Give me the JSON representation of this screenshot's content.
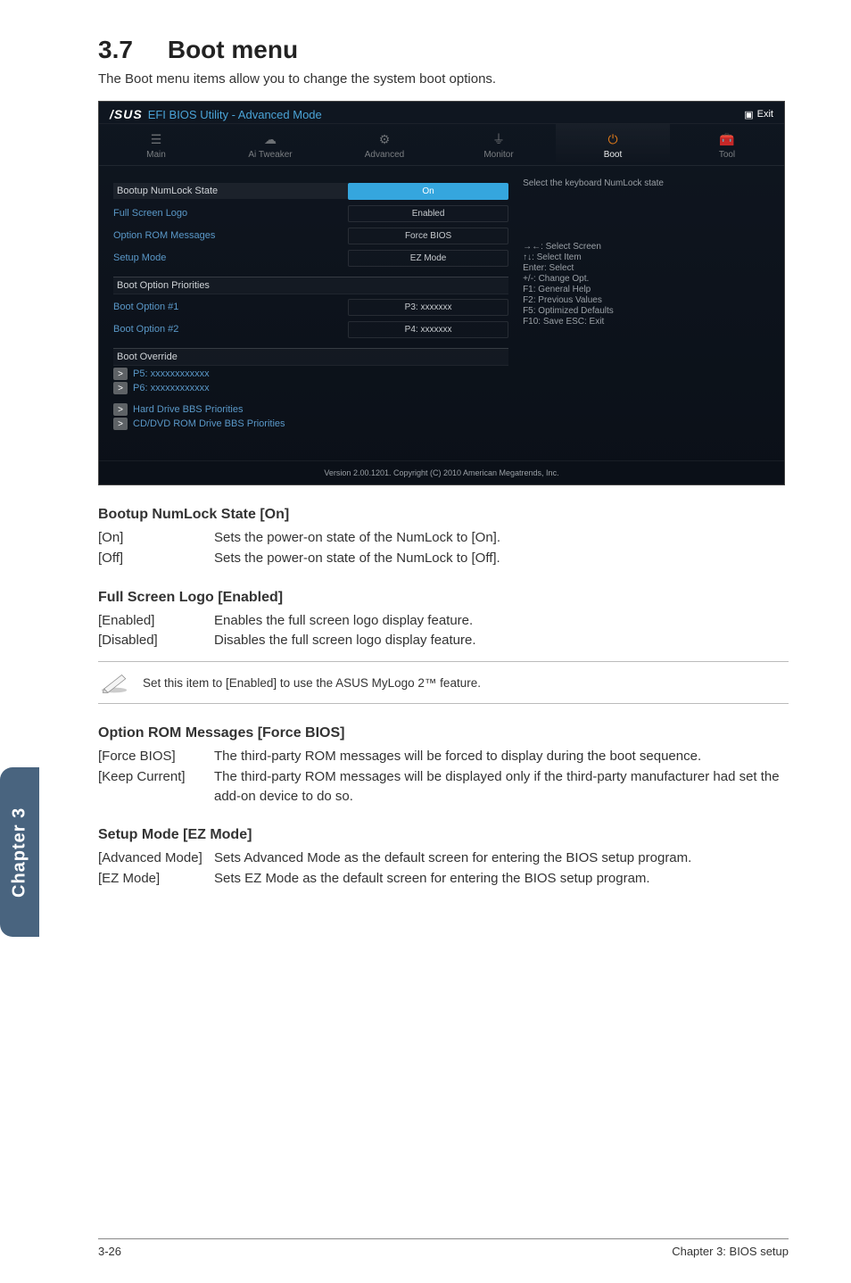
{
  "section": {
    "number": "3.7",
    "title": "Boot menu"
  },
  "intro": "The Boot menu items allow you to change the system boot options.",
  "bios": {
    "logo": "/SUS",
    "utility_title": "EFI BIOS Utility - Advanced Mode",
    "exit_label": "Exit",
    "tabs": {
      "main": "Main",
      "ai_tweaker": "Ai Tweaker",
      "advanced": "Advanced",
      "monitor": "Monitor",
      "boot": "Boot",
      "tool": "Tool"
    },
    "help_text": "Select the keyboard NumLock state",
    "fields": {
      "numlock": {
        "label": "Bootup NumLock State",
        "value": "On"
      },
      "fullscreen": {
        "label": "Full Screen Logo",
        "value": "Enabled"
      },
      "oprom": {
        "label": "Option ROM Messages",
        "value": "Force BIOS"
      },
      "setupmode": {
        "label": "Setup Mode",
        "value": "EZ Mode"
      }
    },
    "boot_priorities": {
      "header": "Boot Option Priorities",
      "opt1": {
        "label": "Boot Option #1",
        "value": "P3: xxxxxxx"
      },
      "opt2": {
        "label": "Boot Option #2",
        "value": "P4: xxxxxxx"
      }
    },
    "override": {
      "header": "Boot Override",
      "p5": "P5: xxxxxxxxxxxx",
      "p6": "P6: xxxxxxxxxxxx",
      "hdd": "Hard Drive BBS Priorities",
      "cddvd": "CD/DVD ROM Drive BBS Priorities"
    },
    "help_keys": {
      "k1": "→←: Select Screen",
      "k2": "↑↓: Select Item",
      "k3": "Enter: Select",
      "k4": "+/-: Change Opt.",
      "k5": "F1: General Help",
      "k6": "F2: Previous Values",
      "k7": "F5: Optimized Defaults",
      "k8": "F10: Save   ESC: Exit"
    },
    "footer": "Version 2.00.1201.  Copyright (C) 2010 American Megatrends, Inc."
  },
  "doc": {
    "numlock": {
      "heading": "Bootup NumLock State [On]",
      "on_key": "[On]",
      "on_val": "Sets the power-on state of the NumLock to [On].",
      "off_key": "[Off]",
      "off_val": "Sets the power-on state of the NumLock to [Off]."
    },
    "fullscreen": {
      "heading": "Full Screen Logo [Enabled]",
      "en_key": "[Enabled]",
      "en_val": "Enables the full screen logo display feature.",
      "dis_key": "[Disabled]",
      "dis_val": "Disables the full screen logo display feature."
    },
    "note": "Set this item to [Enabled] to use the ASUS MyLogo 2™ feature.",
    "oprom": {
      "heading": "Option ROM Messages [Force BIOS]",
      "force_key": "[Force BIOS]",
      "force_val": "The third-party ROM messages will be forced to display during the boot sequence.",
      "keep_key": "[Keep Current]",
      "keep_val": "The third-party ROM messages will be displayed only if the third-party manufacturer had set the add-on device to do so."
    },
    "setupmode": {
      "heading": "Setup Mode [EZ Mode]",
      "adv_key": "[Advanced Mode]",
      "adv_val": "Sets Advanced Mode as the default screen for entering the BIOS setup program.",
      "ez_key": "[EZ Mode]",
      "ez_val": "Sets EZ Mode as the default screen for entering the BIOS setup program."
    }
  },
  "side_tab": "Chapter 3",
  "footer": {
    "left": "3-26",
    "right": "Chapter 3: BIOS setup"
  }
}
